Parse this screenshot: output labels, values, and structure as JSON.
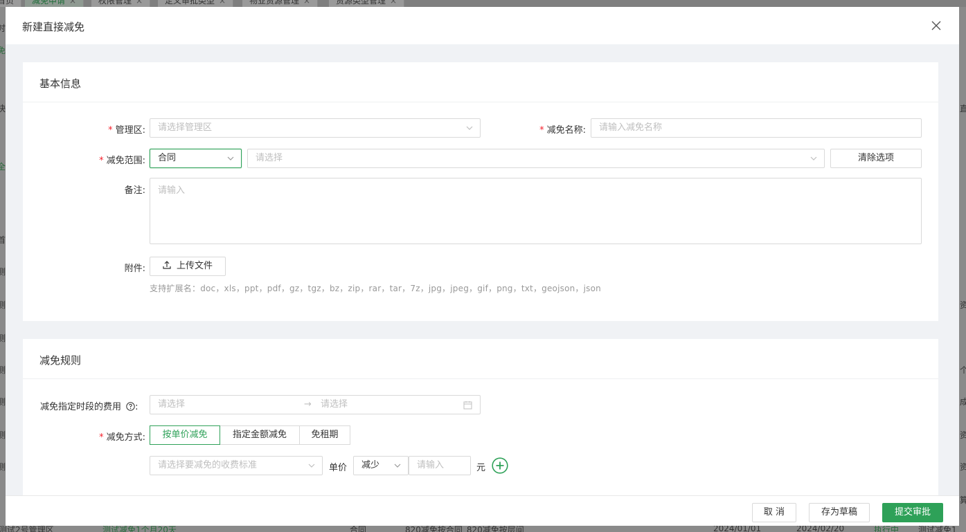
{
  "background": {
    "tabs": [
      {
        "label": "首页",
        "close": ""
      },
      {
        "label": "减免申请",
        "close": "×"
      },
      {
        "label": "权限管理",
        "close": "×"
      },
      {
        "label": "定义审批类型",
        "close": "×"
      },
      {
        "label": "物业资源管理",
        "close": "×"
      },
      {
        "label": "资源类型管理",
        "close": "×"
      }
    ],
    "left_fragments": [
      "时",
      "免",
      "快",
      "全",
      "首",
      "测",
      "测",
      "测",
      "测",
      "测",
      "测",
      "测"
    ],
    "right_fragments": [
      "直",
      "资",
      "个",
      "成",
      "资",
      "资",
      "算"
    ],
    "bottom_fragments": [
      "测试2号管理区",
      "测试减免1个月20天",
      "合同",
      "820减免按合同_820减免按层间",
      "2024/01/01",
      "2024/02/20",
      "执行中",
      "测试减免1"
    ]
  },
  "modal": {
    "title": "新建直接减免",
    "basic": {
      "title": "基本信息",
      "area_label": "管理区:",
      "area_placeholder": "请选择管理区",
      "name_label": "减免名称:",
      "name_placeholder": "请输入减免名称",
      "scope_label": "减免范围:",
      "scope_value": "合同",
      "scope_target_placeholder": "请选择",
      "clear_button": "清除选项",
      "remark_label": "备注:",
      "remark_placeholder": "请输入",
      "attach_label": "附件:",
      "upload_button": "上传文件",
      "ext_hint": "支持扩展名：doc，xls，ppt，pdf，gz，tgz，bz，zip，rar，tar，7z，jpg，jpeg，gif，png，txt，geojson，json"
    },
    "rules": {
      "title": "减免规则",
      "period_label": "减免指定时段的费用",
      "period_colon": ":",
      "period_start_placeholder": "请选择",
      "period_separator": "→",
      "period_end_placeholder": "请选择",
      "mode_label": "减免方式:",
      "modes": [
        "按单价减免",
        "指定金额减免",
        "免租期"
      ],
      "active_mode": 0,
      "fee_standard_placeholder": "请选择要减免的收费标准",
      "unit_price_label": "单价",
      "reduce_value": "减少",
      "amount_placeholder": "请输入",
      "currency": "元"
    },
    "footer": {
      "cancel": "取 消",
      "draft": "存为草稿",
      "submit": "提交审批"
    }
  },
  "colors": {
    "accent": "#2ea158",
    "required": "#f5222d"
  }
}
